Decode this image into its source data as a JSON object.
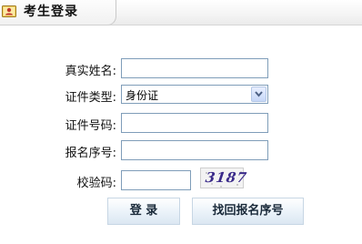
{
  "header": {
    "title": "考生登录",
    "icon": "user-card-icon"
  },
  "form": {
    "real_name_label": "真实姓名:",
    "real_name_value": "",
    "id_type_label": "证件类型:",
    "id_type_value": "身份证",
    "id_number_label": "证件号码:",
    "id_number_value": "",
    "reg_number_label": "报名序号:",
    "reg_number_value": "",
    "captcha_label": "校验码:",
    "captcha_value": "",
    "captcha_text": "3187"
  },
  "buttons": {
    "login": "登 录",
    "recover": "找回报名序号"
  },
  "colors": {
    "input_border": "#7f9db9",
    "captcha_text": "#3a2a8a",
    "button_border": "#c7d6e4"
  }
}
